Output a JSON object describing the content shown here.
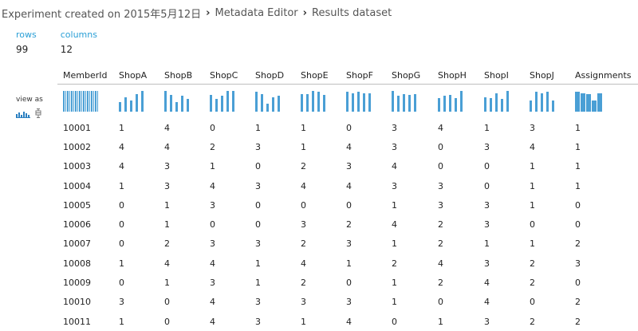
{
  "breadcrumb": {
    "experiment": "Experiment created on 2015年5月12日",
    "module": "Metadata Editor",
    "current": "Results dataset",
    "separator": "›"
  },
  "stats": {
    "rows_label": "rows",
    "rows_value": "99",
    "columns_label": "columns",
    "columns_value": "12"
  },
  "view_as": {
    "label": "view as",
    "icons": [
      "histogram-icon",
      "boxplot-icon"
    ]
  },
  "table": {
    "columns": [
      "MemberId",
      "ShopA",
      "ShopB",
      "ShopC",
      "ShopD",
      "ShopE",
      "ShopF",
      "ShopG",
      "ShopH",
      "ShopI",
      "ShopJ",
      "Assignments"
    ],
    "rows": [
      [
        "10001",
        "1",
        "4",
        "0",
        "1",
        "1",
        "0",
        "3",
        "4",
        "1",
        "3",
        "1"
      ],
      [
        "10002",
        "4",
        "4",
        "2",
        "3",
        "1",
        "4",
        "3",
        "0",
        "3",
        "4",
        "1"
      ],
      [
        "10003",
        "4",
        "3",
        "1",
        "0",
        "2",
        "3",
        "4",
        "0",
        "0",
        "1",
        "1"
      ],
      [
        "10004",
        "1",
        "3",
        "4",
        "3",
        "4",
        "4",
        "3",
        "3",
        "0",
        "1",
        "1"
      ],
      [
        "10005",
        "0",
        "1",
        "3",
        "0",
        "0",
        "0",
        "1",
        "3",
        "3",
        "1",
        "0"
      ],
      [
        "10006",
        "0",
        "1",
        "0",
        "0",
        "3",
        "2",
        "4",
        "2",
        "3",
        "0",
        "0"
      ],
      [
        "10007",
        "0",
        "2",
        "3",
        "3",
        "2",
        "3",
        "1",
        "2",
        "1",
        "1",
        "2"
      ],
      [
        "10008",
        "1",
        "4",
        "4",
        "1",
        "4",
        "1",
        "2",
        "4",
        "3",
        "2",
        "3"
      ],
      [
        "10009",
        "0",
        "1",
        "3",
        "1",
        "2",
        "0",
        "1",
        "2",
        "4",
        "2",
        "0"
      ],
      [
        "10010",
        "3",
        "0",
        "4",
        "3",
        "3",
        "3",
        "1",
        "0",
        "4",
        "0",
        "2"
      ],
      [
        "10011",
        "1",
        "0",
        "4",
        "3",
        "1",
        "4",
        "0",
        "1",
        "3",
        "2",
        "2"
      ]
    ],
    "histograms": [
      [
        1,
        1,
        1,
        1,
        1,
        1,
        1,
        1,
        1,
        1,
        1,
        1,
        1,
        1,
        1,
        1,
        1,
        1
      ],
      [
        0.45,
        0.7,
        0.55,
        0.85,
        1.0
      ],
      [
        1.0,
        0.8,
        0.45,
        0.75,
        0.6
      ],
      [
        0.8,
        0.6,
        0.75,
        1.0,
        1.0
      ],
      [
        0.95,
        0.85,
        0.4,
        0.7,
        0.75
      ],
      [
        0.85,
        0.85,
        1.0,
        0.95,
        0.8
      ],
      [
        0.95,
        0.9,
        0.95,
        0.9,
        0.9
      ],
      [
        1.0,
        0.75,
        0.85,
        0.8,
        0.85
      ],
      [
        0.65,
        0.75,
        0.8,
        0.65,
        1.0
      ],
      [
        0.7,
        0.65,
        0.9,
        0.6,
        1.0
      ],
      [
        0.55,
        0.95,
        0.9,
        0.95,
        0.55
      ],
      [
        0.95,
        0.9,
        0.85,
        0.55,
        0.9
      ]
    ]
  },
  "colors": {
    "accent": "#2a9fd6",
    "bars": "#4a9fd5"
  }
}
